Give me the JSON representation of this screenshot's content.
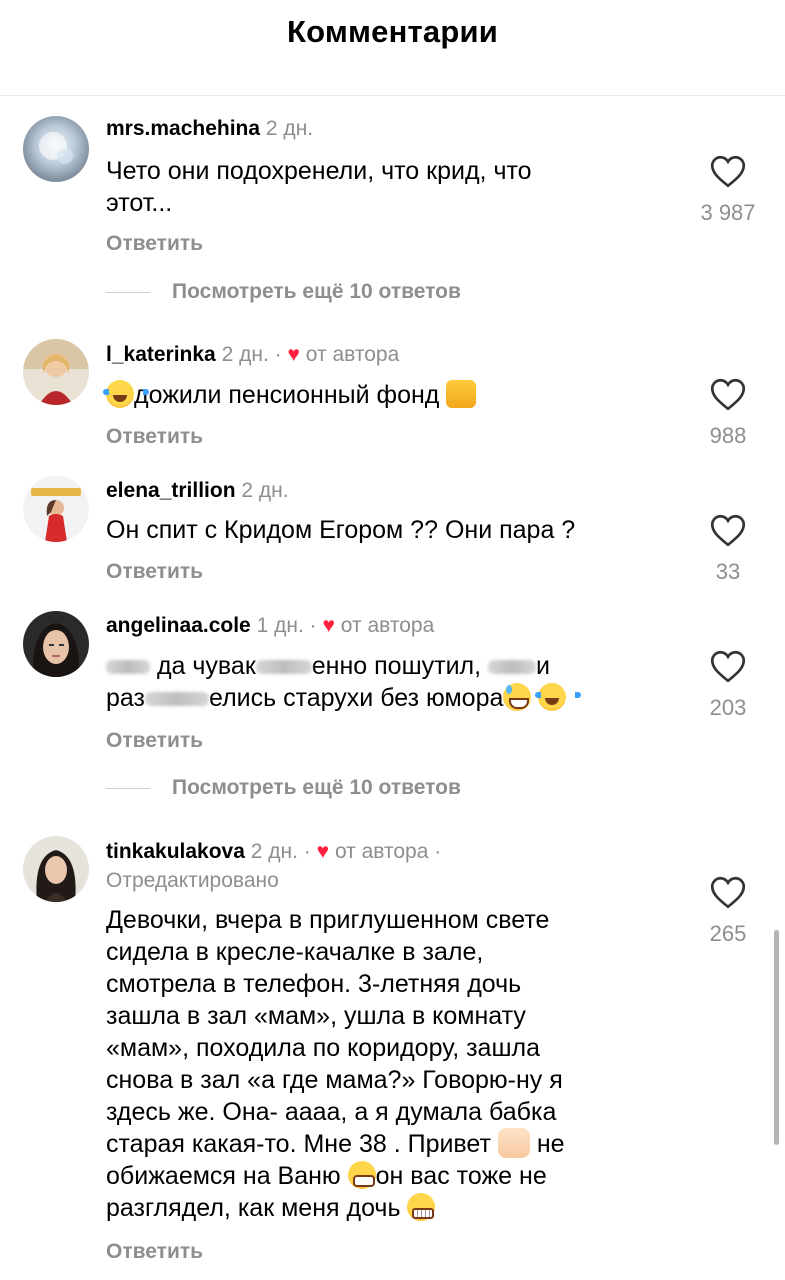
{
  "header": {
    "title": "Комментарии"
  },
  "reply_label": "Ответить",
  "comments": [
    {
      "username": "mrs.machehina",
      "time": "2 дн.",
      "text_lines": [
        "Чето они подохренели, что крид, что",
        "этот..."
      ],
      "likes": "3 987"
    },
    {
      "username": "l_katerinka",
      "time": "2 дн.",
      "separator": "·",
      "author_badge": "от автора",
      "text": "дожили пенсионный фонд",
      "likes": "988"
    },
    {
      "username": "elena_trillion",
      "time": "2 дн.",
      "text": "Он спит с Кридом Егором ?? Они пара ?",
      "likes": "33"
    },
    {
      "username": "angelinaa.cole",
      "time": "1 дн.",
      "separator": "·",
      "author_badge": "от автора",
      "line1": {
        "a": "да чувак",
        "b": "енно пошутил,",
        "c": "и"
      },
      "line2": {
        "a": "раз",
        "b": "елись старухи без юмора"
      },
      "likes": "203"
    },
    {
      "username": "tinkakulakova",
      "time": "2 дн.",
      "separator": "·",
      "author_badge": "от автора",
      "separator2": "·",
      "edited": "Отредактировано",
      "text_lines": [
        "Девочки, вчера в приглушенном свете",
        "сидела в кресле-качалке в зале,",
        "смотрела в телефон. 3-летняя дочь",
        "зашла в зал «мам», ушла в комнату",
        "«мам», походила по коридору, зашла",
        "снова в зал «а где мама?» Говорю-ну я",
        "здесь же. Она- аааа, а я думала бабка",
        "старая какая-то. Мне 38 . Привет"
      ],
      "line9_a": "не",
      "line10_a": "обижаемся на Ваню",
      "line10_b": "он вас тоже не",
      "line11": "разглядел, как меня дочь",
      "likes": "265"
    }
  ],
  "view_more": [
    {
      "label": "Посмотреть ещё 10 ответов"
    },
    {
      "label": "Посмотреть ещё 10 ответов"
    }
  ],
  "colors": {
    "author_heart": "#ff1f3f",
    "muted_text": "#8e8e8e"
  }
}
